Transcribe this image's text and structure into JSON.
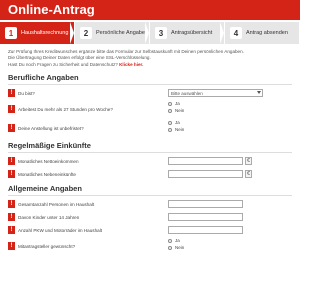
{
  "header": {
    "title": "Online-Antrag"
  },
  "steps": [
    {
      "number": "1",
      "label": "Haushaltsrechnung",
      "active": true
    },
    {
      "number": "2",
      "label": "Persönliche Angaben",
      "active": false
    },
    {
      "number": "3",
      "label": "Antragsübersicht",
      "active": false
    },
    {
      "number": "4",
      "label": "Antrag absenden",
      "active": false
    }
  ],
  "intro": {
    "line1": "Zur Prüfung Ihres Kreditwunsches ergänze bitte das Formular zur Selbstauskunft mit Deinen persönlichen Angaben.",
    "line2": "Die Übertragung Deiner Daten erfolgt über eine SSL-Verschlüsselung.",
    "line3": "Hast Du noch Fragen zu Sicherheit und Datenschutz?",
    "link": "Klicke hier."
  },
  "sections": {
    "beruf": {
      "title": "Berufliche Angaben",
      "job_label": "Du bist?",
      "job_select": "Bitte auswählen",
      "hours_label": "Arbeitest Du mehr als 27 Stunden pro Woche?",
      "fixed_label": "Deine Anstellung ist unbefristet?"
    },
    "einkuenfte": {
      "title": "Regelmäßige Einkünfte",
      "net_label": "Monatliches Nettoeinkommen",
      "side_label": "Monatliches Nebeneinkünfte",
      "currency": "€"
    },
    "allgemein": {
      "title": "Allgemeine Angaben",
      "persons_label": "Gesamtanzahl Personen im Haushalt",
      "children_label": "Davon Kinder unter 14 Jahren",
      "cars_label": "Anzahl PKW und Motorräder im Haushalt",
      "co_label": "Mitantragsteller gewünscht?"
    }
  },
  "radio": {
    "yes": "Ja",
    "no": "Nein"
  },
  "colors": {
    "accent": "#d42418"
  }
}
